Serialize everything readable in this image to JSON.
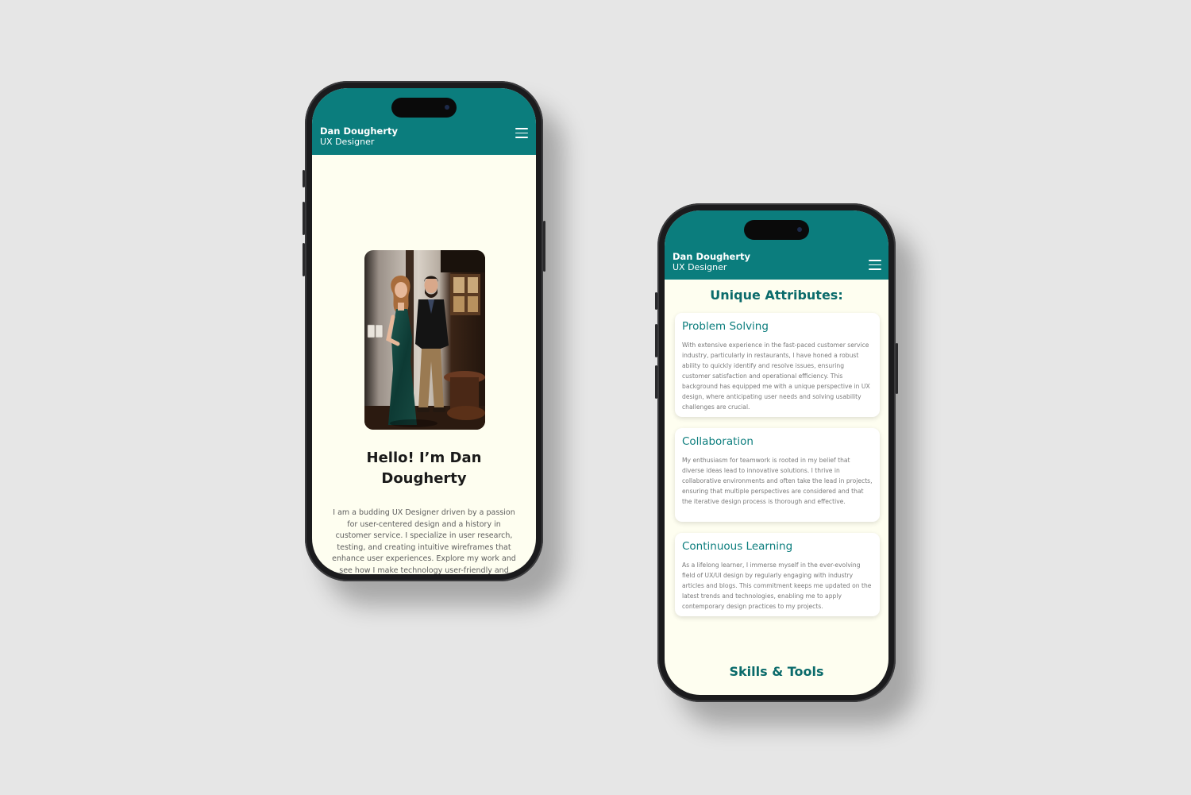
{
  "colors": {
    "background": "#e6e6e6",
    "header": "#0b7d7d",
    "screen_bg": "#fefef0",
    "accent_text": "#0b6b6b"
  },
  "phone_left": {
    "header": {
      "name": "Dan Dougherty",
      "role": "UX Designer",
      "menu_icon": "hamburger-menu-icon"
    },
    "hero": {
      "title": "Hello! I’m Dan Dougherty",
      "text": "I am a budding UX Designer driven by a passion for user-centered design and a history in customer service. I specialize in user research, testing, and creating intuitive wireframes that enhance user experiences. Explore my work and see how I make technology user-friendly and visually appealing."
    }
  },
  "phone_right": {
    "header": {
      "name": "Dan Dougherty",
      "role": "UX Designer",
      "menu_icon": "hamburger-menu-icon"
    },
    "section_title": "Unique Attributes:",
    "attributes": [
      {
        "title": "Problem Solving",
        "text": "With extensive experience in the fast-paced customer service industry, particularly in restaurants, I have honed a robust ability to quickly identify and resolve issues, ensuring customer satisfaction and operational efficiency. This background has equipped me with a unique perspective in UX design, where anticipating user needs and solving usability challenges are crucial."
      },
      {
        "title": "Collaboration",
        "text": "My enthusiasm for teamwork is rooted in my belief that diverse ideas lead to innovative solutions. I thrive in collaborative environments and often take the lead in projects, ensuring that multiple perspectives are considered and that the iterative design process is thorough and effective."
      },
      {
        "title": "Continuous Learning",
        "text": "As a lifelong learner, I immerse myself in the ever-evolving field of UX/UI design by regularly engaging with industry articles and blogs. This commitment keeps me updated on the latest trends and technologies, enabling me to apply contemporary design practices to my projects."
      }
    ],
    "skills_title": "Skills & Tools"
  }
}
